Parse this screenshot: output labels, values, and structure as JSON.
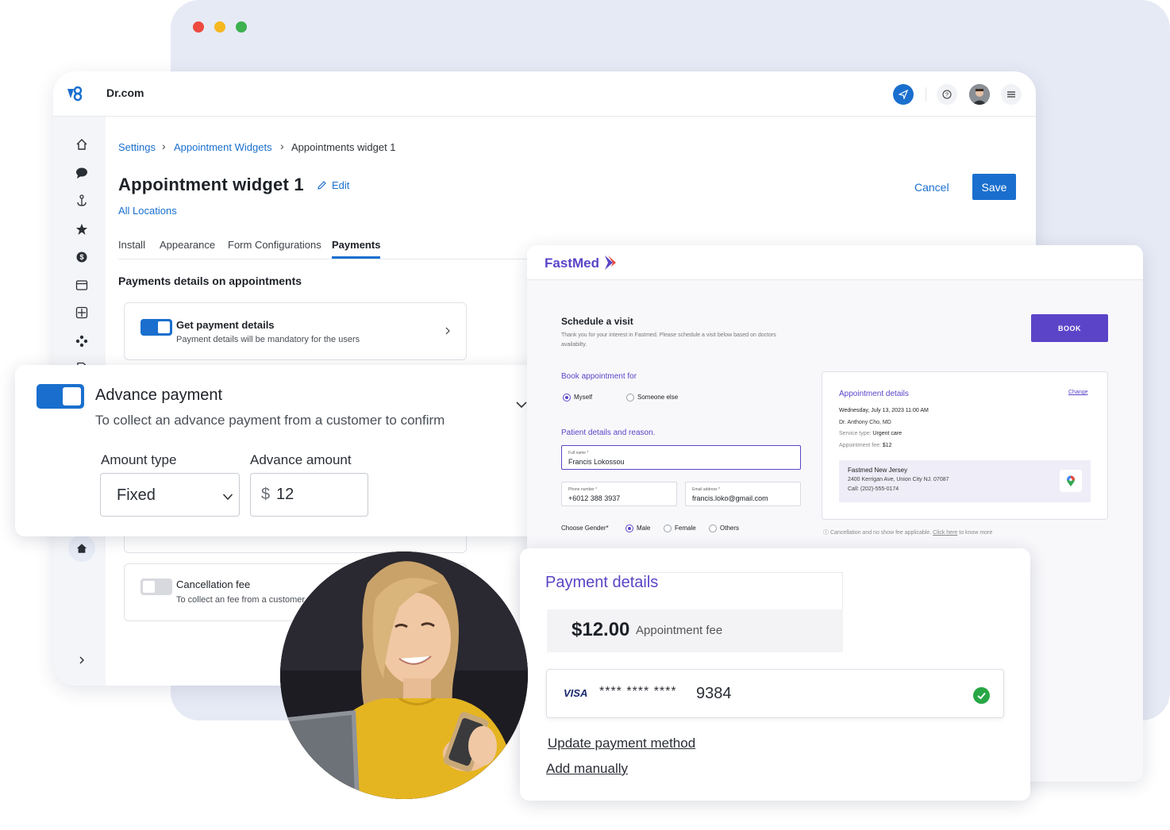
{
  "window": {
    "title": "Dr.com"
  },
  "breadcrumb": {
    "items": [
      "Settings",
      "Appointment Widgets",
      "Appointments widget 1"
    ]
  },
  "page": {
    "title": "Appointment widget 1",
    "edit_label": "Edit",
    "subtitle_link": "All Locations"
  },
  "actions": {
    "cancel_label": "Cancel",
    "save_label": "Save"
  },
  "tabs": [
    {
      "label": "Install"
    },
    {
      "label": "Appearance"
    },
    {
      "label": "Form Configurations"
    },
    {
      "label": "Payments",
      "active": true
    }
  ],
  "payments": {
    "section_title": "Payments details on appointments",
    "get_payment": {
      "title": "Get payment details",
      "subtitle": "Payment details will be mandatory for the users",
      "enabled": true
    },
    "advance": {
      "title": "Advance payment",
      "subtitle": "To collect an advance payment from a customer to confirm",
      "enabled": true,
      "amount_type_label": "Amount type",
      "amount_type_value": "Fixed",
      "advance_amount_label": "Advance amount",
      "currency": "$",
      "amount_value": "12"
    },
    "cancellation": {
      "title": "Cancellation fee",
      "subtitle": "To collect an fee from a customer",
      "enabled": false
    }
  },
  "fastmed": {
    "brand": "FastMed",
    "schedule_title": "Schedule a visit",
    "schedule_sub": "Thank you for your interest in Fastmed. Please schedule a visit below based on doctors availabilty.",
    "book_label": "BOOK",
    "book_for_label": "Book appointment for",
    "book_for_options": [
      "Myself",
      "Someone else"
    ],
    "patient_label": "Patient details and reason.",
    "full_name_label": "Full name *",
    "full_name_value": "Francis Lokossou",
    "phone_label": "Phone number *",
    "phone_value": "+6012 388 3937",
    "email_label": "Email address *",
    "email_value": "francis.loko@gmail.com",
    "gender_label": "Choose Gender*",
    "gender_options": [
      "Male",
      "Female",
      "Others"
    ],
    "appt": {
      "title": "Appointment details",
      "change": "Change",
      "datetime": "Wednesday, July 13, 2023 11:00 AM",
      "doctor": "Dr. Anthony Cho, MD",
      "service_label": "Service type:",
      "service_value": "Urgent care",
      "fee_label": "Appointment fee:",
      "fee_value": "$12",
      "location_name": "Fastmed New Jersey",
      "location_addr": "2400 Kerrigan Ave, Union City NJ. 07087",
      "location_call": "Call: (202)-555-0174"
    },
    "note_pre": "Cancellation and no show fee applicable.",
    "note_link": "Click here",
    "note_post": "to know more"
  },
  "payment_card": {
    "title": "Payment details",
    "fee_amount": "$12.00",
    "fee_label": "Appointment fee",
    "card_brand": "VISA",
    "card_masked": "**** **** ****",
    "card_last4": "9384",
    "update_link": "Update payment method",
    "add_link": "Add manually"
  },
  "colors": {
    "primary": "#1a6fce",
    "brand_purple": "#5b44c7",
    "success": "#27a745"
  },
  "icons": [
    "home-icon",
    "chat-icon",
    "anchor-icon",
    "star-icon",
    "dollar-icon",
    "calendar-icon",
    "grid-icon",
    "network-icon",
    "file-icon",
    "send-icon",
    "help-icon",
    "menu-icon",
    "chevron-right-icon",
    "chevron-down-icon",
    "pencil-icon",
    "check-circle-icon",
    "map-pin-icon"
  ]
}
